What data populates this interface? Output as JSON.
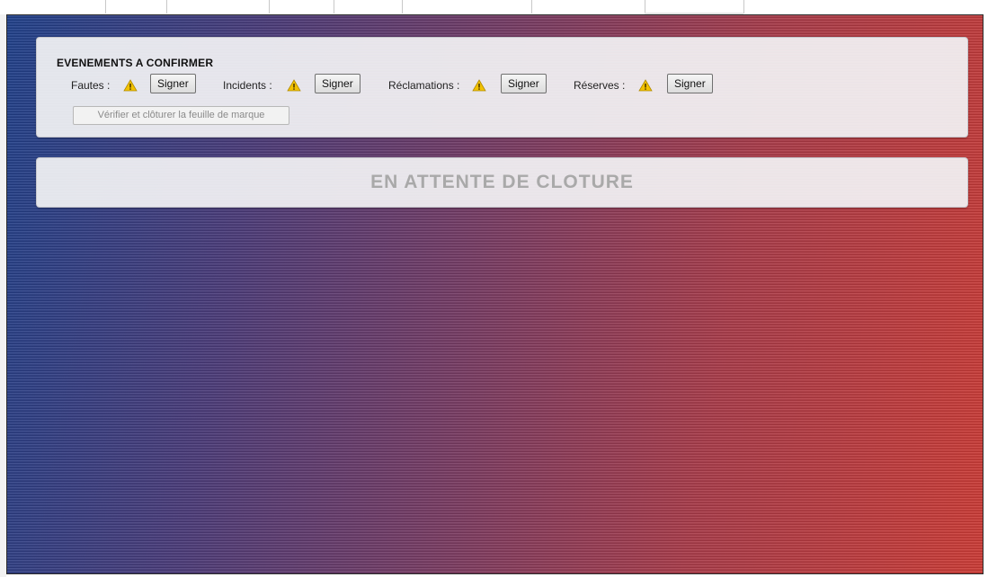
{
  "events": {
    "title": "EVENEMENTS A CONFIRMER",
    "items": [
      {
        "label": "Fautes :",
        "button": "Signer"
      },
      {
        "label": "Incidents :",
        "button": "Signer"
      },
      {
        "label": "Réclamations :",
        "button": "Signer"
      },
      {
        "label": "Réserves :",
        "button": "Signer"
      }
    ],
    "close_button": "Vérifier et clôturer la feuille de marque"
  },
  "status": {
    "text": "EN ATTENTE DE CLOTURE"
  },
  "icons": {
    "warning": "warning-icon"
  },
  "colors": {
    "gradient_left": "#1e3f8a",
    "gradient_right": "#cc3a34",
    "warning_yellow": "#f2c200",
    "status_text": "#a9a9a9"
  }
}
